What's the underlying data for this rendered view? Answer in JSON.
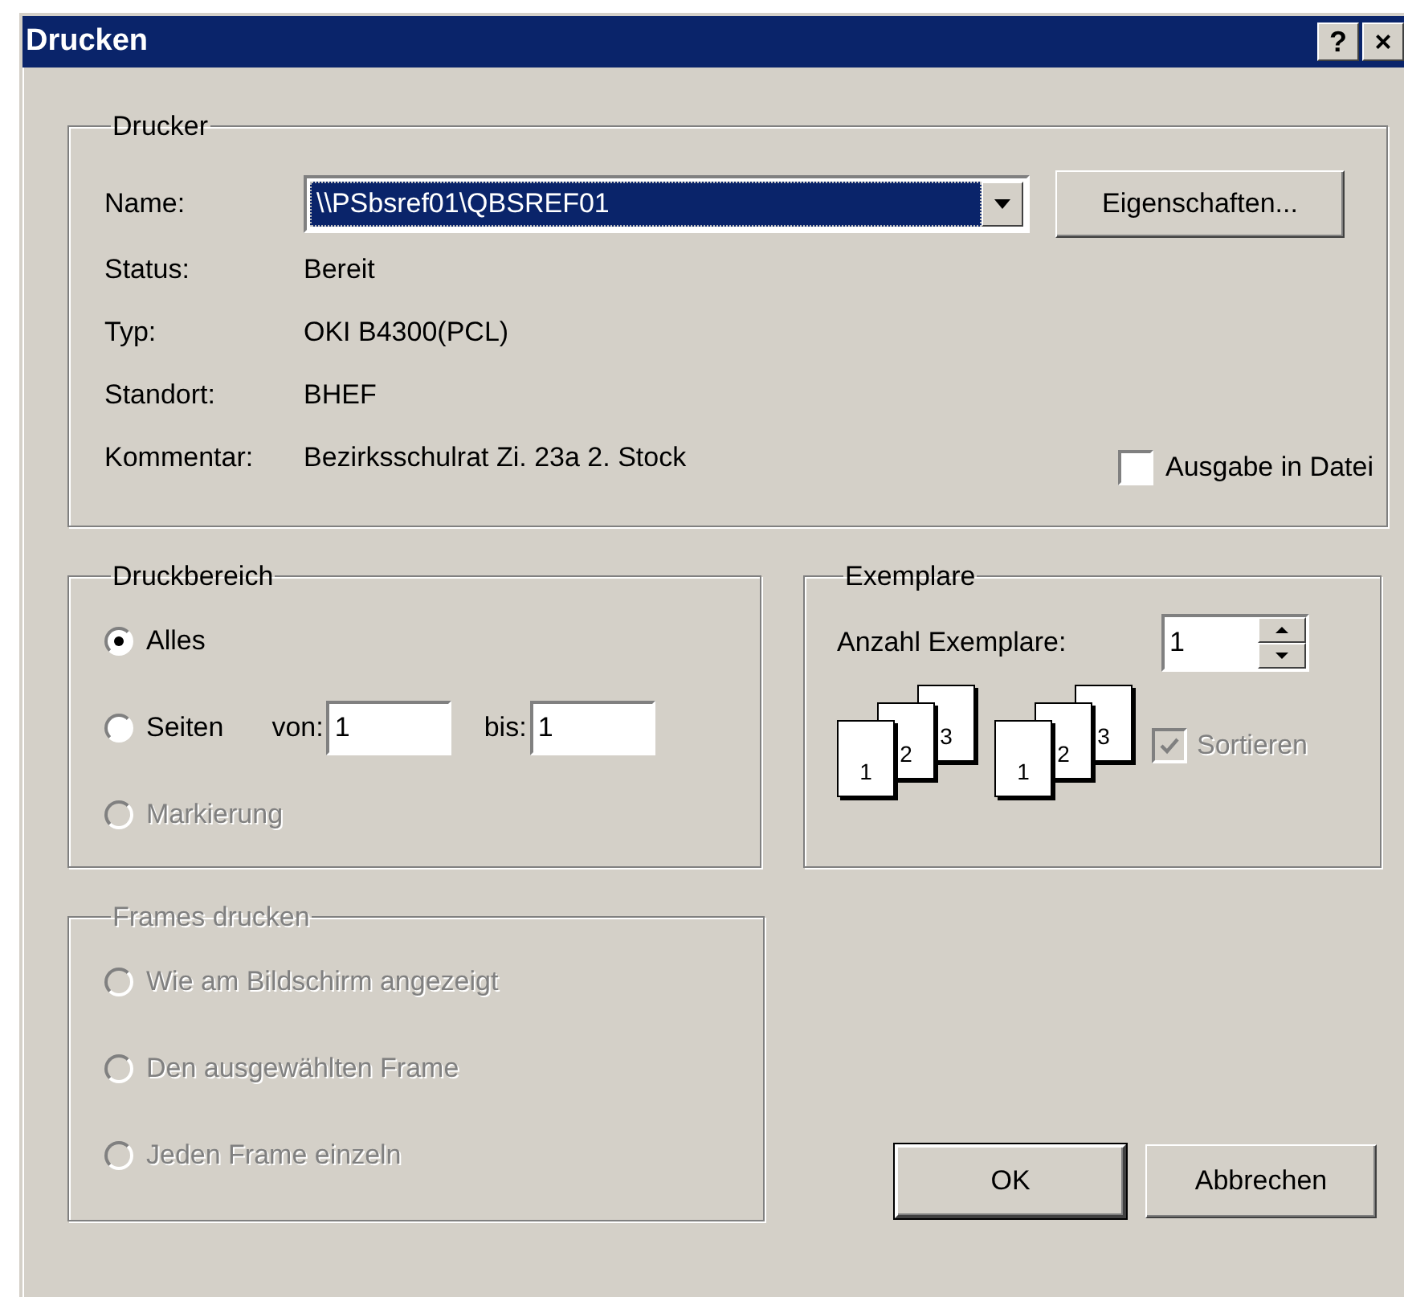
{
  "window": {
    "title": "Drucken",
    "title_buttons": [
      "?",
      "×"
    ]
  },
  "printer": {
    "legend": "Drucker",
    "name_label": "Name:",
    "name_value": "\\\\PSbsref01\\QBSREF01",
    "properties_button": "Eigenschaften...",
    "info": [
      {
        "label": "Status:",
        "value": "Bereit"
      },
      {
        "label": "Typ:",
        "value": "OKI B4300(PCL)"
      },
      {
        "label": "Standort:",
        "value": "BHEF"
      },
      {
        "label": "Kommentar:",
        "value": "Bezirksschulrat Zi. 23a 2. Stock"
      }
    ],
    "print_to_file": {
      "label": "Ausgabe in Datei",
      "checked": false
    }
  },
  "range": {
    "legend": "Druckbereich",
    "options": [
      {
        "kind": "plain",
        "label": "Alles",
        "selected": true,
        "disabled": false
      },
      {
        "kind": "pages",
        "label": "Seiten",
        "selected": false,
        "disabled": false,
        "from_label": "von:",
        "from_value": "1",
        "to_label": "bis:",
        "to_value": "1"
      },
      {
        "kind": "plain",
        "label": "Markierung",
        "selected": false,
        "disabled": true
      }
    ]
  },
  "copies": {
    "legend": "Exemplare",
    "count_label": "Anzahl Exemplare:",
    "count_value": "1",
    "illustrations": [
      {
        "pages": [
          "1",
          "2",
          "3"
        ]
      },
      {
        "pages": [
          "1",
          "2",
          "3"
        ]
      }
    ],
    "collate": {
      "label": "Sortieren",
      "checked": true,
      "disabled": true
    }
  },
  "frames": {
    "legend": "Frames drucken",
    "disabled": true,
    "options": [
      {
        "label": "Wie am Bildschirm angezeigt",
        "selected": false
      },
      {
        "label": "Den ausgewählten Frame",
        "selected": false
      },
      {
        "label": "Jeden Frame einzeln",
        "selected": false
      }
    ]
  },
  "buttons": [
    {
      "label": "OK",
      "default": true
    },
    {
      "label": "Abbrechen",
      "default": false
    }
  ]
}
